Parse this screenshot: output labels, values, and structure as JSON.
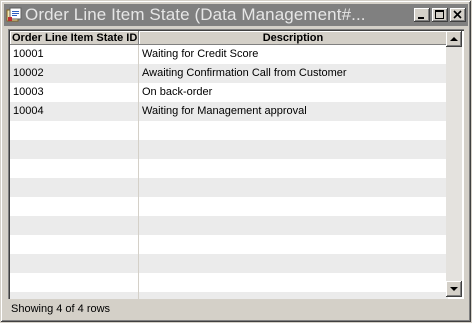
{
  "window": {
    "title": "Order Line Item State (Data Management#...",
    "buttons": {
      "minimize": "minimize",
      "maximize": "maximize",
      "close": "close"
    }
  },
  "table": {
    "columns": [
      "Order Line Item State ID",
      "Description"
    ],
    "rows": [
      {
        "id": "10001",
        "description": "Waiting for Credit Score"
      },
      {
        "id": "10002",
        "description": "Awaiting Confirmation Call from Customer"
      },
      {
        "id": "10003",
        "description": "On back-order"
      },
      {
        "id": "10004",
        "description": "Waiting for Management approval"
      }
    ]
  },
  "status": {
    "text": "Showing 4 of 4 rows"
  },
  "icons": {
    "app": "window-app-icon",
    "minimize": "minimize-icon",
    "maximize": "maximize-icon",
    "close": "close-icon",
    "scroll_up": "arrow-up-icon",
    "scroll_down": "arrow-down-icon"
  }
}
